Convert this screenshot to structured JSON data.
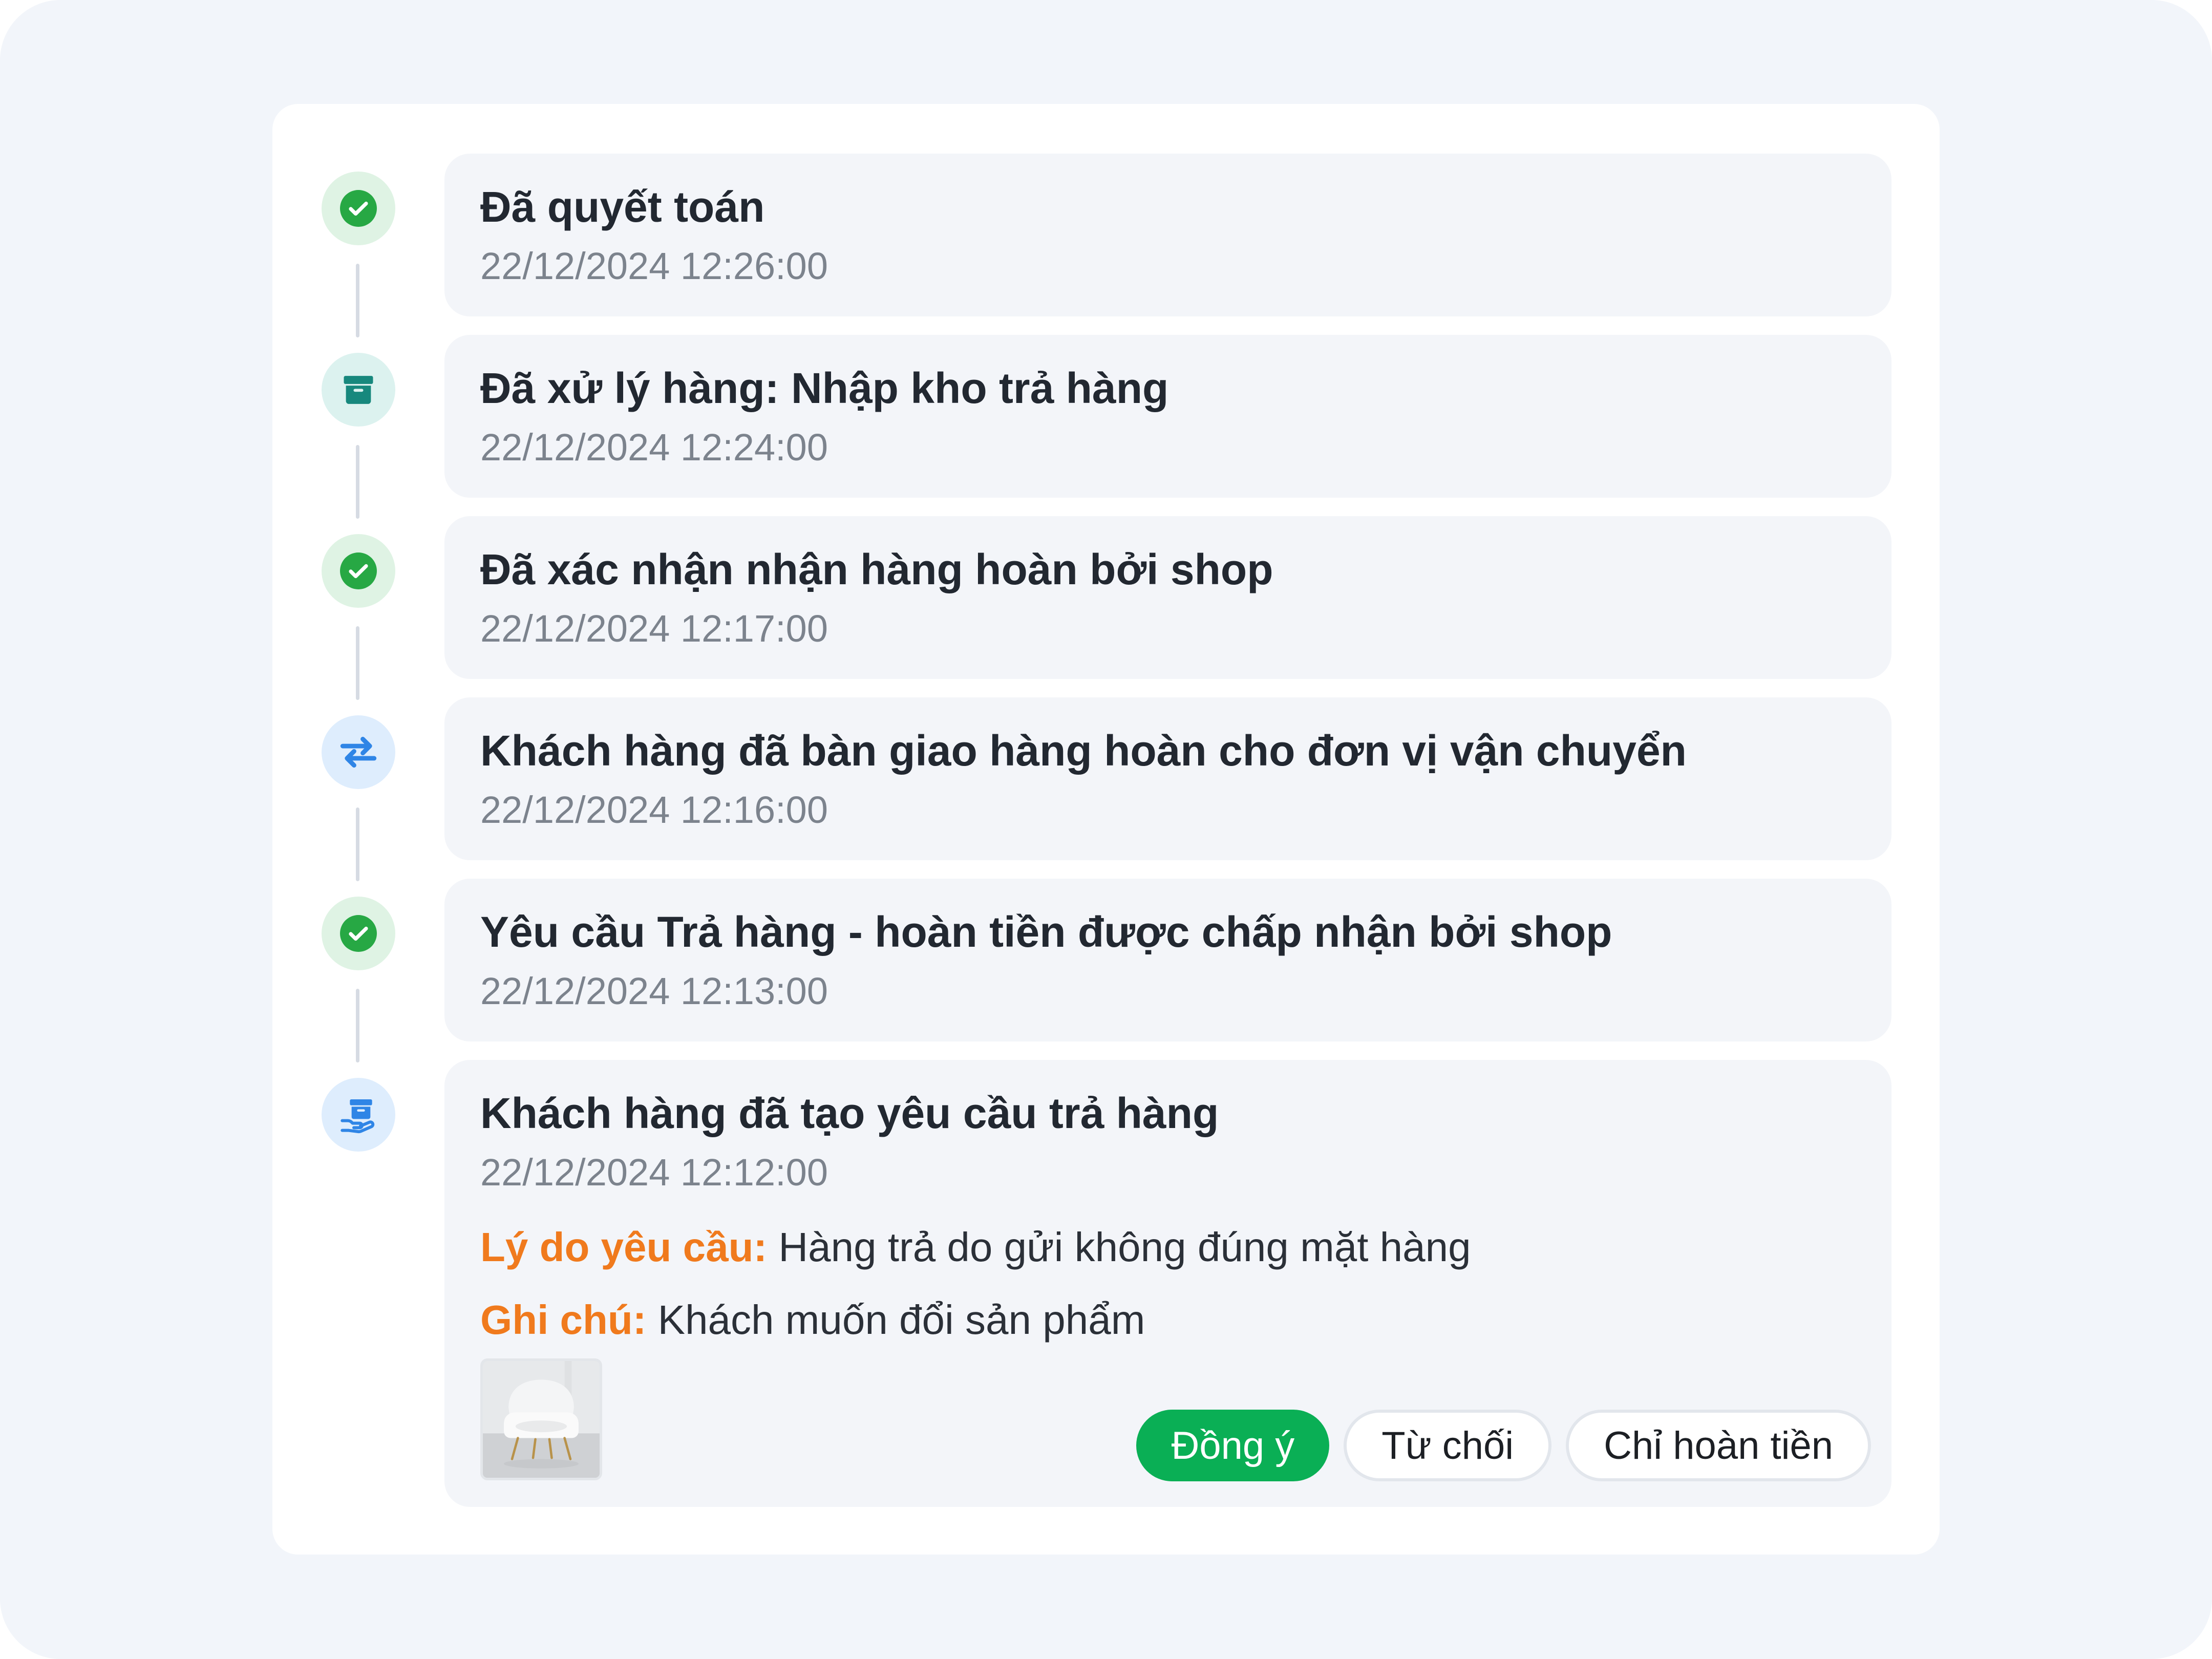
{
  "timeline": {
    "entries": [
      {
        "title": "Đã quyết toán",
        "time": "22/12/2024 12:26:00",
        "icon": "check-circle-icon",
        "status": "green"
      },
      {
        "title": "Đã xử lý hàng: Nhập kho trả hàng",
        "time": "22/12/2024 12:24:00",
        "icon": "archive-box-icon",
        "status": "teal"
      },
      {
        "title": "Đã xác nhận nhận hàng hoàn bởi shop",
        "time": "22/12/2024 12:17:00",
        "icon": "check-circle-icon",
        "status": "green"
      },
      {
        "title": "Khách hàng đã bàn giao hàng hoàn cho đơn vị vận chuyển",
        "time": "22/12/2024 12:16:00",
        "icon": "swap-arrows-icon",
        "status": "blue"
      },
      {
        "title": "Yêu cầu Trả hàng - hoàn tiền được chấp nhận bởi shop",
        "time": "22/12/2024 12:13:00",
        "icon": "check-circle-icon",
        "status": "green"
      },
      {
        "title": "Khách hàng đã tạo yêu cầu trả hàng",
        "time": "22/12/2024 12:12:00",
        "icon": "return-package-icon",
        "status": "blue",
        "reason_label": "Lý do yêu cầu:",
        "reason_value": " Hàng trả do gửi không đúng mặt hàng",
        "note_label": "Ghi chú:",
        "note_value": " Khách muốn đổi sản phẩm",
        "image": "white-armchair-photo",
        "actions": {
          "accept": "Đồng ý",
          "reject": "Từ chối",
          "refund_only": "Chỉ hoàn tiền"
        }
      }
    ]
  },
  "colors": {
    "success": "#27a844",
    "teal": "#17887d",
    "blue": "#2f85e6",
    "accent_orange": "#f07a1d",
    "primary_button": "#0aaf55"
  }
}
